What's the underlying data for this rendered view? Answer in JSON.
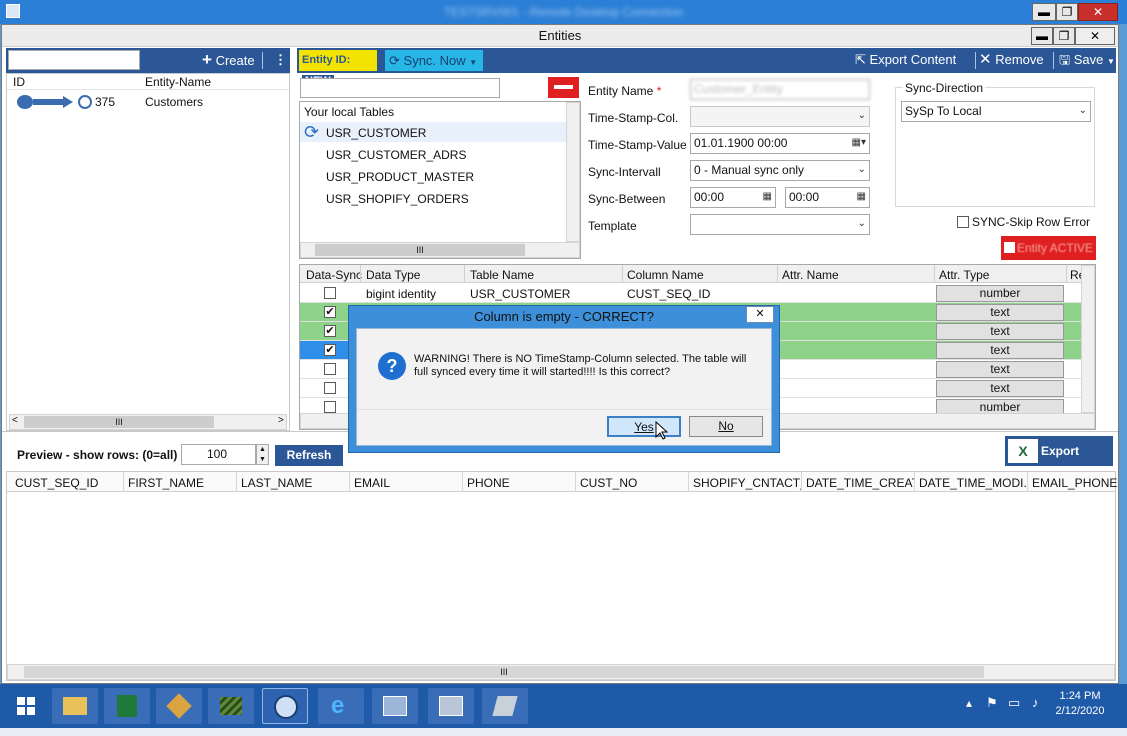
{
  "remote_session": {
    "title": "TESTSRV001 - Remote Desktop Connection"
  },
  "window": {
    "title": "Entities",
    "min": "▬",
    "max": "❐",
    "close": "✕"
  },
  "left_panel": {
    "search_value": "",
    "create_label": "Create",
    "columns": [
      "ID",
      "Entity-Name"
    ],
    "rows": [
      {
        "id": "375",
        "name": "Customers"
      }
    ]
  },
  "toolbar": {
    "entity_id_label": "Entity ID:",
    "entity_id_value": "NEW",
    "sync_now_label": "Sync. Now",
    "export_content_label": "Export Content",
    "remove_label": "Remove",
    "save_label": "Save"
  },
  "tables_panel": {
    "filter_value": "",
    "header": "Your local Tables",
    "items": [
      "USR_CUSTOMER",
      "USR_CUSTOMER_ADRS",
      "USR_PRODUCT_MASTER",
      "USR_SHOPIFY_ORDERS"
    ],
    "hscroll_grip": "III"
  },
  "form": {
    "entity_name_label": "Entity Name",
    "required_mark": "*",
    "entity_name_value": "Customer_Entity",
    "timestamp_col_label": "Time-Stamp-Col.",
    "timestamp_col_value": "",
    "timestamp_value_label": "Time-Stamp-Value",
    "timestamp_value": "01.01.1900 00:00",
    "sync_interval_label": "Sync-Intervall",
    "sync_interval_value": "0 - Manual sync only",
    "sync_between_label": "Sync-Between",
    "sync_between_from": "00:00",
    "sync_between_to": "00:00",
    "template_label": "Template",
    "template_value": ""
  },
  "sync_direction": {
    "label": "Sync-Direction",
    "value": "SySp To Local"
  },
  "skip_row_error_label": "SYNC-Skip Row Error",
  "entity_active_label": "Entity ACTIVE",
  "grid": {
    "columns": [
      "Data-Sync",
      "Data Type",
      "Table Name",
      "Column Name",
      "Attr. Name",
      "Attr. Type",
      "Re"
    ],
    "rows": [
      {
        "checked": false,
        "data_type": "bigint identity",
        "table": "USR_CUSTOMER",
        "column": "CUST_SEQ_ID",
        "attr_type": "number",
        "status": "normal"
      },
      {
        "checked": true,
        "data_type": "",
        "table": "",
        "column": "",
        "attr_type": "text",
        "status": "synced"
      },
      {
        "checked": true,
        "data_type": "",
        "table": "",
        "column": "",
        "attr_type": "text",
        "status": "synced"
      },
      {
        "checked": true,
        "data_type": "",
        "table": "",
        "column": "",
        "attr_type": "text",
        "status": "selected"
      },
      {
        "checked": false,
        "data_type": "",
        "table": "",
        "column": "",
        "attr_type": "text",
        "status": "normal"
      },
      {
        "checked": false,
        "data_type": "",
        "table": "",
        "column": "",
        "attr_type": "text",
        "status": "normal"
      },
      {
        "checked": false,
        "data_type": "",
        "table": "",
        "column": "",
        "attr_type": "number",
        "status": "normal"
      }
    ]
  },
  "preview": {
    "label": "Preview - show rows: (0=all)",
    "rows_value": "100",
    "refresh_label": "Refresh",
    "export_excel_label": "Export Excel",
    "columns": [
      "CUST_SEQ_ID",
      "FIRST_NAME",
      "LAST_NAME",
      "EMAIL",
      "PHONE",
      "CUST_NO",
      "SHOPIFY_CNTACT_...",
      "DATE_TIME_CREAT...",
      "DATE_TIME_MODI...",
      "EMAIL_PHONE"
    ],
    "hscroll_grip": "III"
  },
  "dialog": {
    "title": "Column is empty - CORRECT?",
    "message": "WARNING! There is NO TimeStamp-Column selected. The table will full synced every time it will started!!!! Is this correct?",
    "yes_label": "Yes",
    "no_label": "No",
    "close_label": "✕"
  },
  "taskbar": {
    "time": "1:24 PM",
    "date": "2/12/2020"
  },
  "colors": {
    "accent_blue": "#2b5796",
    "sync_cyan": "#27b7e6",
    "entity_id_yellow": "#f2e300",
    "remove_red": "#e02020",
    "synced_row_green": "#8fd38a",
    "selected_row_blue": "#2f8fe8",
    "taskbar_blue": "#1f5aa8"
  }
}
